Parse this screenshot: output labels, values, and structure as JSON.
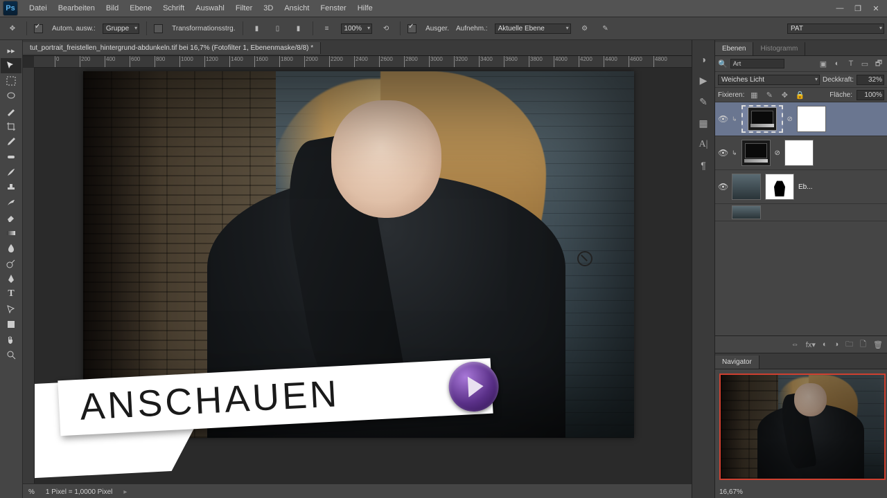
{
  "menu": {
    "items": [
      "Datei",
      "Bearbeiten",
      "Bild",
      "Ebene",
      "Schrift",
      "Auswahl",
      "Filter",
      "3D",
      "Ansicht",
      "Fenster",
      "Hilfe"
    ]
  },
  "optbar": {
    "auto": "Autom. ausw.:",
    "group": "Gruppe",
    "transform": "Transformationsstrg.",
    "zoom": "100%",
    "ausger": "Ausger.",
    "aufnehm": "Aufnehm.:",
    "ebene": "Aktuelle Ebene",
    "workspace": "PAT"
  },
  "doc": {
    "title": "tut_portrait_freistellen_hintergrund-abdunkeln.tif bei 16,7% (Fotofilter 1, Ebenenmaske/8/8) *"
  },
  "ruler": [
    "0",
    "200",
    "400",
    "600",
    "800",
    "1000",
    "1200",
    "1400",
    "1600",
    "1800",
    "2000",
    "2200",
    "2400",
    "2600",
    "2800",
    "3000",
    "3200",
    "3400",
    "3600",
    "3800",
    "4000",
    "4200",
    "4400",
    "4600",
    "4800"
  ],
  "status": {
    "zoom": "%",
    "info": "1 Pixel = 1,0000 Pixel"
  },
  "banner": "ANSCHAUEN",
  "panels": {
    "tabs": {
      "layers": "Ebenen",
      "hist": "Histogramm"
    },
    "filter": "Art",
    "blend": "Weiches Licht",
    "opacity_l": "Deckkraft:",
    "opacity": "32%",
    "lock": "Fixieren:",
    "fill_l": "Fläche:",
    "fill": "100%",
    "layer3": "Eb...",
    "nav": "Navigator",
    "navzoom": "16,67%"
  }
}
